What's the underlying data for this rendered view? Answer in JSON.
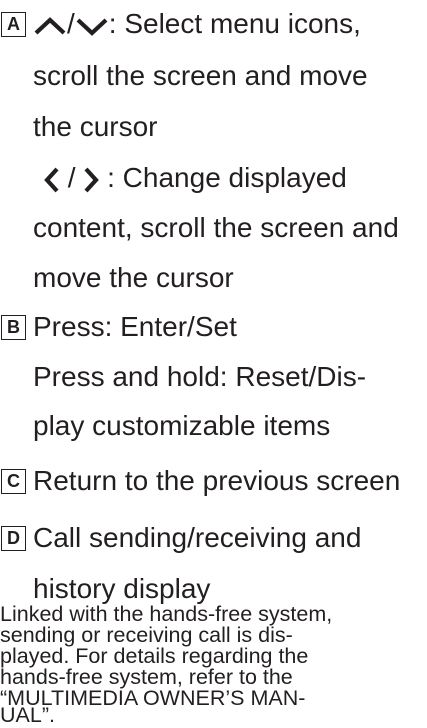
{
  "items": {
    "a": {
      "badge": "A",
      "up_down_sep": "/",
      "up_down_text": ": Select menu icons,",
      "up_down_cont_1": "scroll the screen and move",
      "up_down_cont_2": "the cursor",
      "left_right_sep": " / ",
      "left_right_text": ": Change displayed",
      "left_right_cont_1": "content, scroll the screen and",
      "left_right_cont_2": "move the cursor"
    },
    "b": {
      "badge": "B",
      "line_1": "Press: Enter/Set",
      "line_2": "Press and hold: Reset/Dis-",
      "line_3": "play customizable items"
    },
    "c": {
      "badge": "C",
      "line_1": "Return to the previous screen"
    },
    "d": {
      "badge": "D",
      "line_1": "Call sending/receiving and",
      "line_2": "history display"
    }
  },
  "note": {
    "line_1": "Linked with the hands-free system,",
    "line_2": "sending or receiving call is dis-",
    "line_3": "played. For details regarding the",
    "line_4": "hands-free system, refer to the",
    "line_5": "“MULTIMEDIA OWNER’S MAN-",
    "line_6": "UAL”."
  },
  "icons": {
    "up": "chevron-up-icon",
    "down": "chevron-down-icon",
    "left": "chevron-left-icon",
    "right": "chevron-right-icon"
  }
}
